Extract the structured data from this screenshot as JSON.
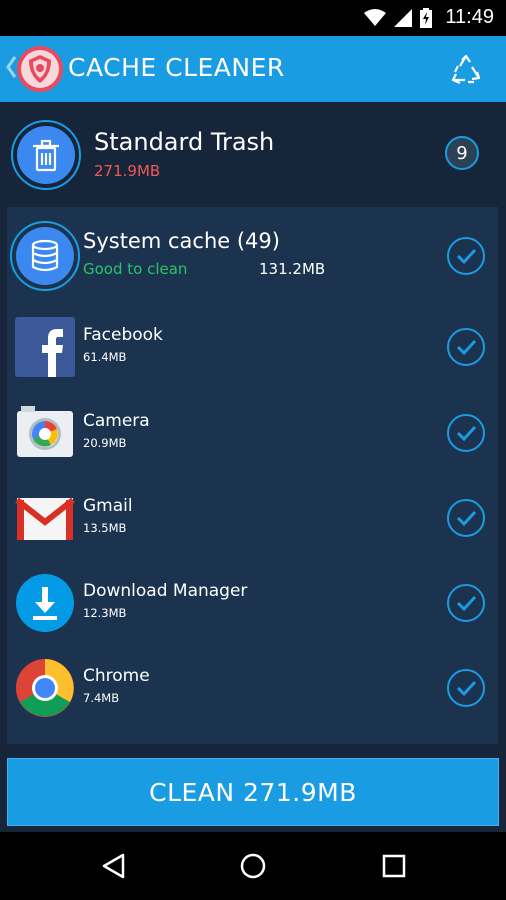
{
  "status_bar": {
    "time": "11:49"
  },
  "app_bar": {
    "title": "CACHE CLEANER"
  },
  "trash": {
    "title": "Standard Trash",
    "size": "271.9MB",
    "count": "9"
  },
  "system_cache": {
    "title": "System cache (49)",
    "status": "Good to clean",
    "size": "131.2MB"
  },
  "apps": [
    {
      "name": "Facebook",
      "size": "61.4MB",
      "icon": "facebook-icon"
    },
    {
      "name": "Camera",
      "size": "20.9MB",
      "icon": "camera-icon"
    },
    {
      "name": "Gmail",
      "size": "13.5MB",
      "icon": "gmail-icon"
    },
    {
      "name": "Download Manager",
      "size": "12.3MB",
      "icon": "download-manager-icon"
    },
    {
      "name": "Chrome",
      "size": "7.4MB",
      "icon": "chrome-icon"
    }
  ],
  "clean_button": {
    "label": "CLEAN 271.9MB"
  },
  "colors": {
    "accent": "#1a9ce3",
    "background": "#17253a",
    "panel": "#1c3350",
    "good": "#27c56a",
    "warning": "#ec5a5a"
  }
}
